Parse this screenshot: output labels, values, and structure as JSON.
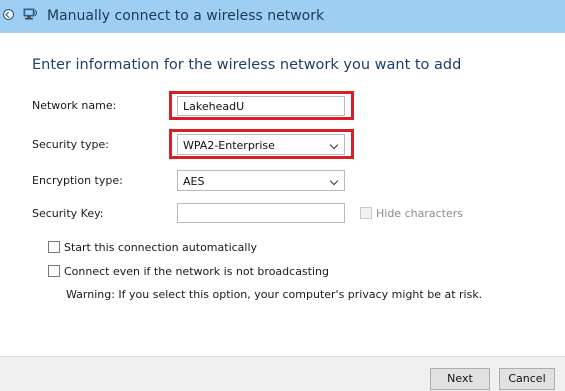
{
  "window": {
    "title": "Manually connect to a wireless network",
    "back_icon": "back-arrow-icon",
    "network_icon": "wireless-network-icon"
  },
  "heading": "Enter information for the wireless network you want to add",
  "form": {
    "network_name": {
      "label": "Network name:",
      "value": "LakeheadU"
    },
    "security_type": {
      "label": "Security type:",
      "value": "WPA2-Enterprise"
    },
    "encryption_type": {
      "label": "Encryption type:",
      "value": "AES"
    },
    "security_key": {
      "label": "Security Key:",
      "value": "",
      "hide_characters_label": "Hide characters"
    }
  },
  "options": {
    "start_automatically": {
      "label": "Start this connection automatically",
      "checked": false
    },
    "connect_not_broadcasting": {
      "label": "Connect even if the network is not broadcasting",
      "checked": false
    },
    "warning": "Warning: If you select this option, your computer's privacy might be at risk."
  },
  "buttons": {
    "next": "Next",
    "cancel": "Cancel"
  },
  "colors": {
    "title_bar": "#9ecff2",
    "heading_text": "#1e3f68",
    "highlight_border": "#d91f26",
    "footer": "#f0f0f0"
  }
}
